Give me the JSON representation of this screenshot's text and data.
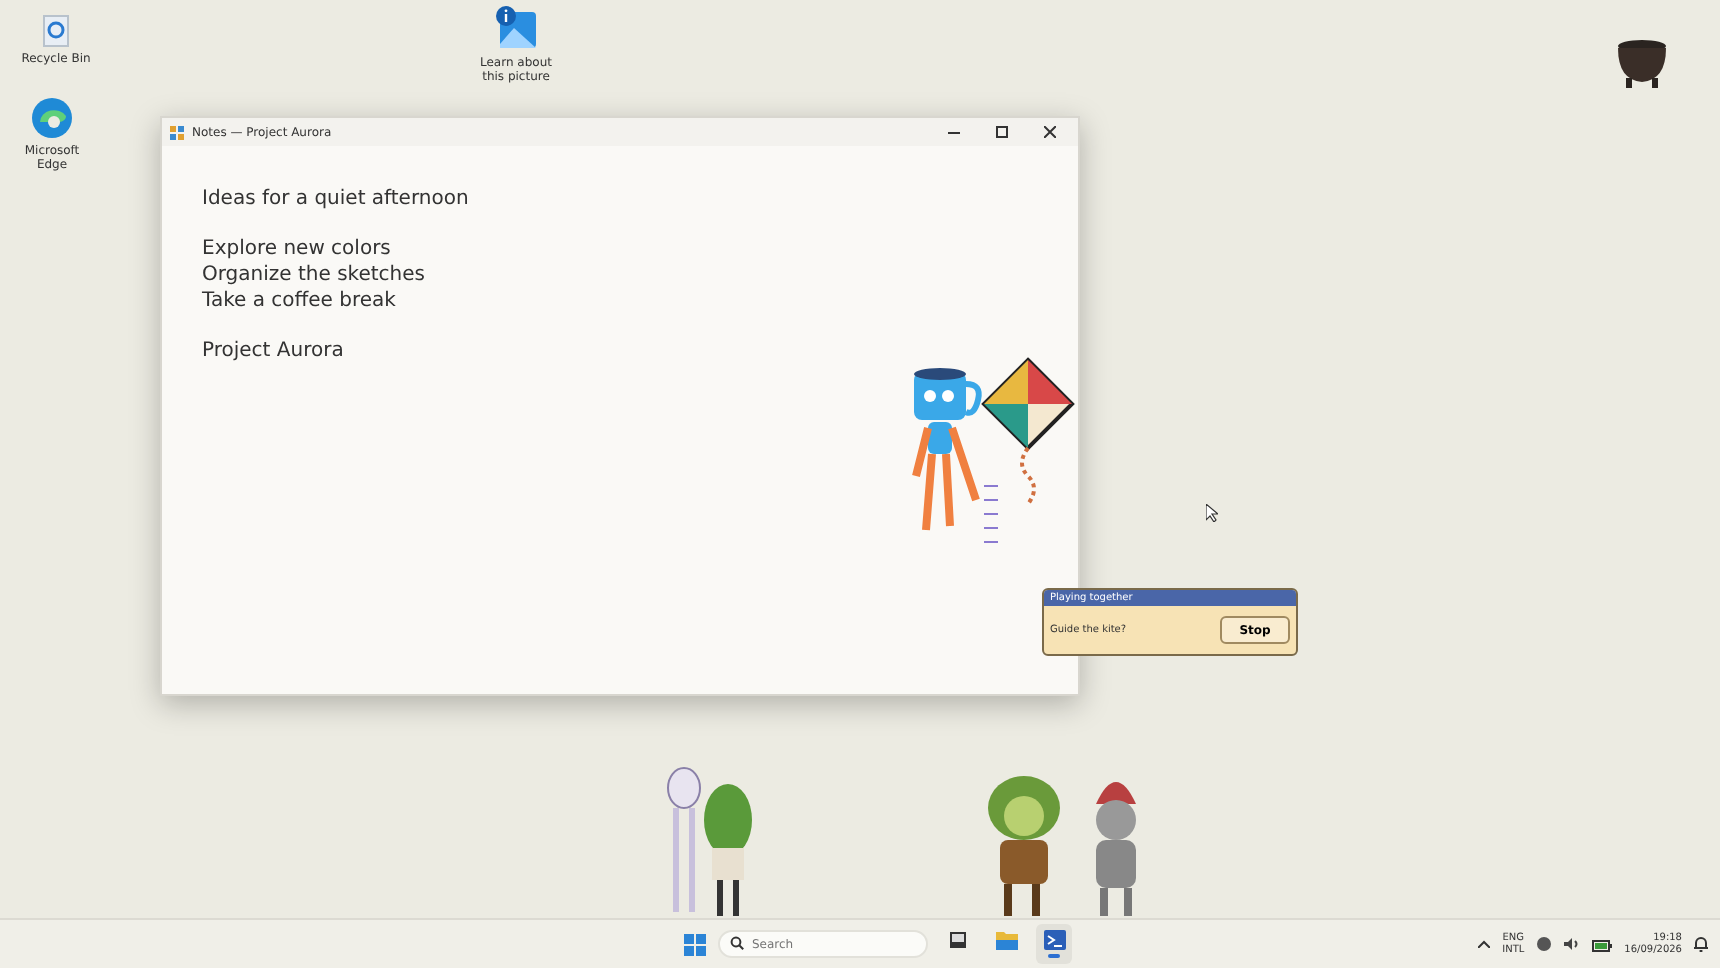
{
  "desktop_icons": [
    {
      "kind": "recycle",
      "label": "Recycle Bin"
    },
    {
      "kind": "edge",
      "label": "Microsoft Edge"
    },
    {
      "kind": "picture",
      "label": "Learn about this picture"
    }
  ],
  "window": {
    "title": "Notes — Project Aurora",
    "paragraphs": [
      [
        "Ideas for a quiet afternoon"
      ],
      [
        "Explore new colors",
        "Organize the sketches",
        "Take a coffee break"
      ],
      [
        "Project Aurora"
      ]
    ]
  },
  "dialog": {
    "title": "Playing together",
    "message": "Guide the kite?",
    "button": "Stop"
  },
  "taskbar": {
    "search": {
      "placeholder": "Search"
    },
    "apps": [
      {
        "kind": "task-view",
        "selected": false
      },
      {
        "kind": "folder",
        "selected": false
      },
      {
        "kind": "terminal",
        "selected": true
      }
    ],
    "language": [
      "ENG",
      "INTL"
    ],
    "time": "19:18",
    "date": "16/09/2026"
  }
}
